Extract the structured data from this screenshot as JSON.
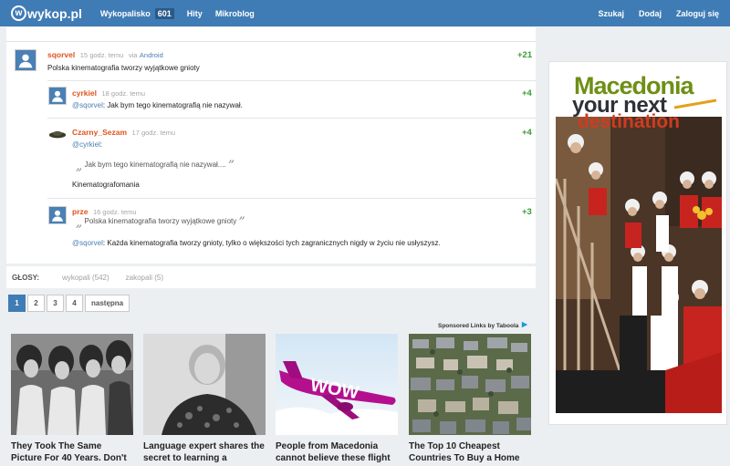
{
  "topbar": {
    "logo_text": "wykop.pl",
    "logo_mark": "w",
    "nav": [
      {
        "label": "Wykopalisko",
        "badge": "601"
      },
      {
        "label": "Hity"
      },
      {
        "label": "Mikroblog"
      }
    ],
    "right": [
      "Szukaj",
      "Dodaj",
      "Zaloguj się"
    ]
  },
  "comments": [
    {
      "author": "sqorvel",
      "time": "15 godz. temu",
      "via": "via",
      "source": "Android",
      "votes": "+21",
      "text": "Polska kinematografia tworzy wyjątkowe gnioty"
    },
    {
      "author": "cyrkiel",
      "time": "18 godz. temu",
      "votes": "+4",
      "mention": "@sqorvel",
      "text": ": Jak bym tego kinematografią nie nazywał."
    },
    {
      "author": "Czarny_Sezam",
      "time": "17 godz. temu",
      "votes": "+4",
      "mention": "@cyrkiel",
      "mention_suffix": ":",
      "quote": "Jak bym tego kinematografią nie nazywał....",
      "text": "Kinematografomania"
    },
    {
      "author": "prze",
      "time": "16 godz. temu",
      "votes": "+3",
      "quote": "Polska kinematografia tworzy wyjątkowe gnioty",
      "mention": "@sqorvel",
      "text": ": Każda kinematografia tworzy gnioty, tylko o większości tych zagranicznych nigdy w życiu nie usłyszysz."
    }
  ],
  "votes_bar": {
    "label": "GŁOSY:",
    "up": "wykopali (542)",
    "down": "zakopali (5)"
  },
  "pager": {
    "pages": [
      "1",
      "2",
      "3",
      "4"
    ],
    "next": "następna",
    "active": "1"
  },
  "sponsored": {
    "label": "Sponsored Links by Taboola"
  },
  "tiles": [
    {
      "title": "They Took The Same Picture For 40 Years. Don't"
    },
    {
      "title": "Language expert shares the secret to learning a"
    },
    {
      "title": "People from Macedonia cannot believe these flight"
    },
    {
      "title": "The Top 10 Cheapest Countries To Buy a Home"
    }
  ],
  "ad": {
    "line1": "Macedonia",
    "line2": "your next",
    "line3": "destination"
  },
  "tile_plane_text": "WOW",
  "colors": {
    "topbar": "#3f7cb5",
    "author": "#e0531f",
    "vote": "#3b9b35",
    "link": "#4a7fb4"
  }
}
